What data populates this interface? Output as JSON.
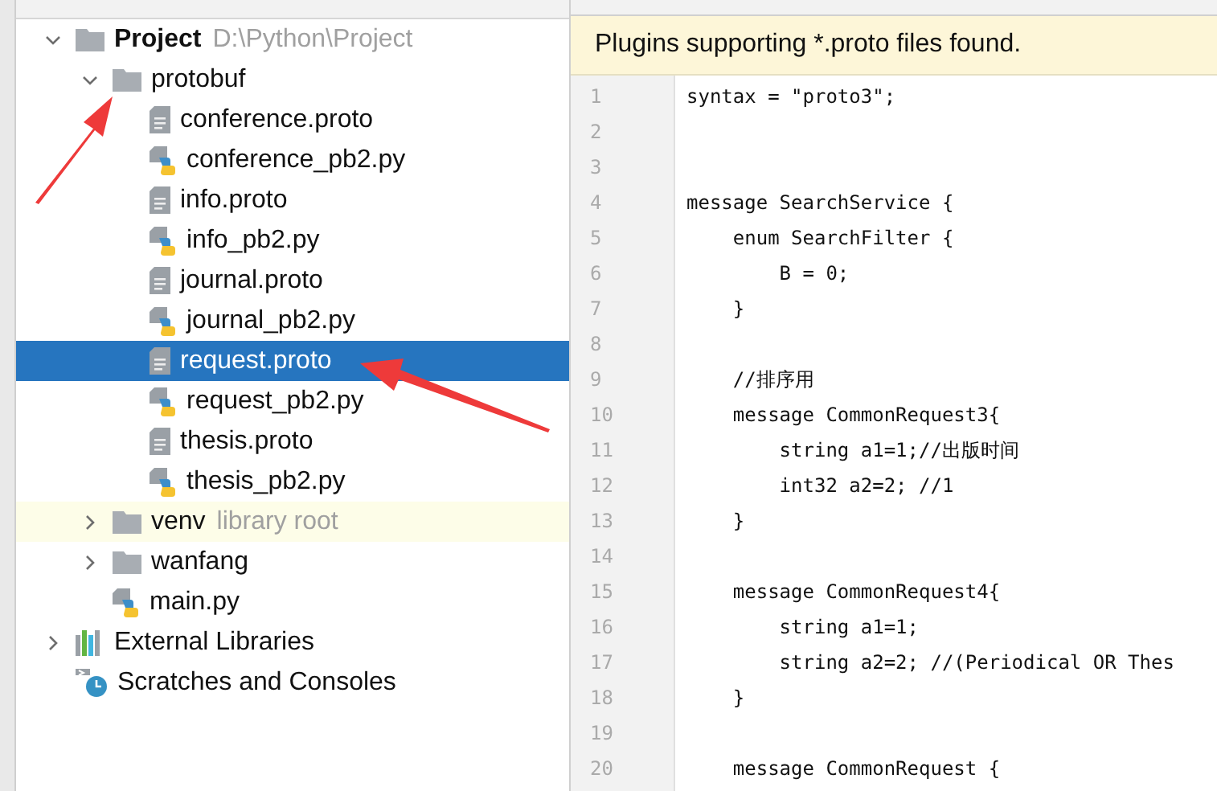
{
  "project_tree": [
    {
      "label": "Project",
      "bold": true,
      "hint": "D:\\Python\\Project",
      "kind": "folder",
      "expanded": true,
      "selected": false,
      "children": [
        {
          "label": "protobuf",
          "kind": "folder",
          "expanded": true,
          "selected": false,
          "children": [
            {
              "label": "conference.proto",
              "kind": "proto",
              "selected": false
            },
            {
              "label": "conference_pb2.py",
              "kind": "python",
              "selected": false
            },
            {
              "label": "info.proto",
              "kind": "proto",
              "selected": false
            },
            {
              "label": "info_pb2.py",
              "kind": "python",
              "selected": false
            },
            {
              "label": "journal.proto",
              "kind": "proto",
              "selected": false
            },
            {
              "label": "journal_pb2.py",
              "kind": "python",
              "selected": false
            },
            {
              "label": "request.proto",
              "kind": "proto",
              "selected": true
            },
            {
              "label": "request_pb2.py",
              "kind": "python",
              "selected": false
            },
            {
              "label": "thesis.proto",
              "kind": "proto",
              "selected": false
            },
            {
              "label": "thesis_pb2.py",
              "kind": "python",
              "selected": false
            }
          ]
        },
        {
          "label": "venv",
          "hint": "library root",
          "kind": "folder",
          "expanded": false,
          "selected": false
        },
        {
          "label": "wanfang",
          "kind": "folder",
          "expanded": false,
          "selected": false
        },
        {
          "label": "main.py",
          "kind": "python",
          "selected": false
        }
      ]
    },
    {
      "label": "External Libraries",
      "kind": "libraries",
      "expanded": false,
      "selected": false
    },
    {
      "label": "Scratches and Consoles",
      "kind": "scratches",
      "selected": false
    }
  ],
  "editor": {
    "banner": "Plugins supporting *.proto files found.",
    "lines": [
      {
        "number": "1",
        "text": "syntax = \"proto3\";"
      },
      {
        "number": "2"
      },
      {
        "number": "3"
      },
      {
        "number": "4",
        "text": "message SearchService {"
      },
      {
        "number": "5",
        "text": "    enum SearchFilter {"
      },
      {
        "number": "6",
        "text": "        B = 0;"
      },
      {
        "number": "7",
        "text": "    }"
      },
      {
        "number": "8"
      },
      {
        "number": "9",
        "text": "    //排序用"
      },
      {
        "number": "10",
        "text": "    message CommonRequest3{"
      },
      {
        "number": "11",
        "text": "        string a1=1;//出版时间"
      },
      {
        "number": "12",
        "text": "        int32 a2=2; //1"
      },
      {
        "number": "13",
        "text": "    }"
      },
      {
        "number": "14"
      },
      {
        "number": "15",
        "text": "    message CommonRequest4{"
      },
      {
        "number": "16",
        "text": "        string a1=1;"
      },
      {
        "number": "17",
        "text": "        string a2=2; //(Periodical OR Thes"
      },
      {
        "number": "18",
        "text": "    }"
      },
      {
        "number": "19"
      },
      {
        "number": "20",
        "text": "    message CommonRequest {"
      }
    ]
  }
}
